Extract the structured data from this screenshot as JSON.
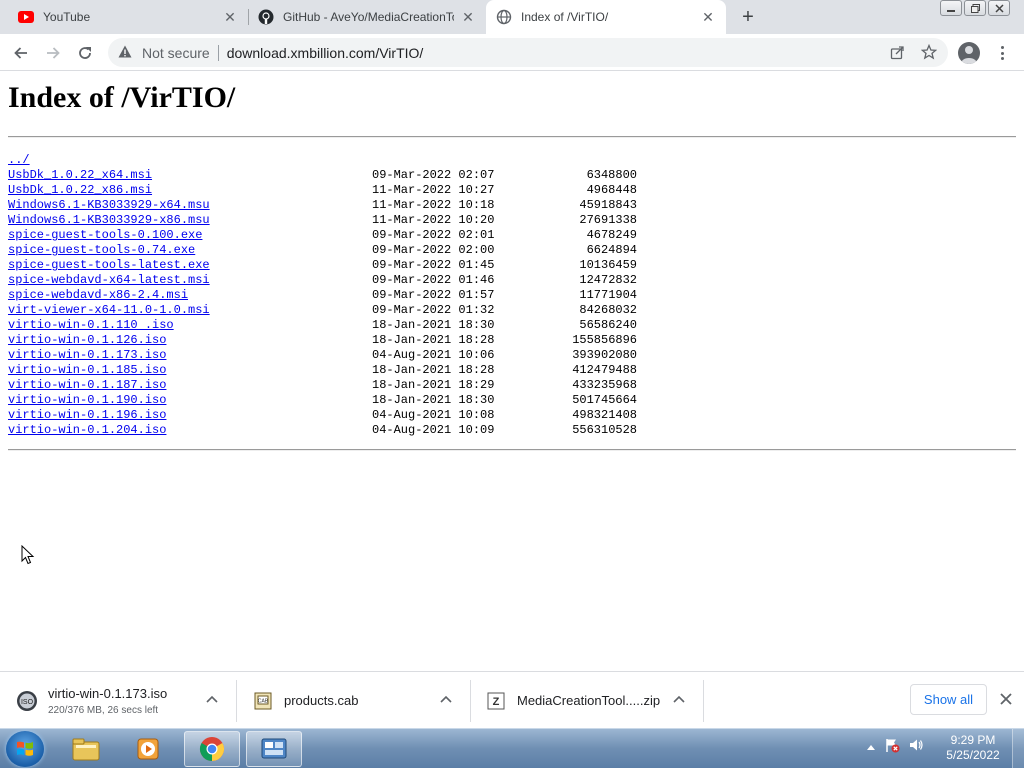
{
  "browser": {
    "tabs": [
      {
        "title": "YouTube",
        "icon": "youtube-icon"
      },
      {
        "title": "GitHub - AveYo/MediaCreationTool",
        "icon": "github-icon"
      },
      {
        "title": "Index of /VirTIO/",
        "icon": "globe-icon",
        "active": true
      }
    ],
    "new_tab": "+",
    "security_label": "Not secure",
    "url": "download.xmbillion.com/VirTIO/"
  },
  "page": {
    "heading": "Index of /VirTIO/",
    "parent_link": "../",
    "files": [
      {
        "name": "UsbDk_1.0.22_x64.msi",
        "date": "09-Mar-2022 02:07",
        "size": "6348800"
      },
      {
        "name": "UsbDk_1.0.22_x86.msi",
        "date": "11-Mar-2022 10:27",
        "size": "4968448"
      },
      {
        "name": "Windows6.1-KB3033929-x64.msu",
        "date": "11-Mar-2022 10:18",
        "size": "45918843"
      },
      {
        "name": "Windows6.1-KB3033929-x86.msu",
        "date": "11-Mar-2022 10:20",
        "size": "27691338"
      },
      {
        "name": "spice-guest-tools-0.100.exe",
        "date": "09-Mar-2022 02:01",
        "size": "4678249"
      },
      {
        "name": "spice-guest-tools-0.74.exe",
        "date": "09-Mar-2022 02:00",
        "size": "6624894"
      },
      {
        "name": "spice-guest-tools-latest.exe",
        "date": "09-Mar-2022 01:45",
        "size": "10136459"
      },
      {
        "name": "spice-webdavd-x64-latest.msi",
        "date": "09-Mar-2022 01:46",
        "size": "12472832"
      },
      {
        "name": "spice-webdavd-x86-2.4.msi",
        "date": "09-Mar-2022 01:57",
        "size": "11771904"
      },
      {
        "name": "virt-viewer-x64-11.0-1.0.msi",
        "date": "09-Mar-2022 01:32",
        "size": "84268032"
      },
      {
        "name": "virtio-win-0.1.110 .iso",
        "date": "18-Jan-2021 18:30",
        "size": "56586240"
      },
      {
        "name": "virtio-win-0.1.126.iso",
        "date": "18-Jan-2021 18:28",
        "size": "155856896"
      },
      {
        "name": "virtio-win-0.1.173.iso",
        "date": "04-Aug-2021 10:06",
        "size": "393902080"
      },
      {
        "name": "virtio-win-0.1.185.iso",
        "date": "18-Jan-2021 18:28",
        "size": "412479488"
      },
      {
        "name": "virtio-win-0.1.187.iso",
        "date": "18-Jan-2021 18:29",
        "size": "433235968"
      },
      {
        "name": "virtio-win-0.1.190.iso",
        "date": "18-Jan-2021 18:30",
        "size": "501745664"
      },
      {
        "name": "virtio-win-0.1.196.iso",
        "date": "04-Aug-2021 10:08",
        "size": "498321408"
      },
      {
        "name": "virtio-win-0.1.204.iso",
        "date": "04-Aug-2021 10:09",
        "size": "556310528"
      }
    ]
  },
  "downloads": {
    "items": [
      {
        "name": "virtio-win-0.1.173.iso",
        "status": "220/376 MB, 26 secs left",
        "icon": "iso-file-icon"
      },
      {
        "name": "products.cab",
        "status": "",
        "icon": "cab-file-icon"
      },
      {
        "name": "MediaCreationTool.....zip",
        "status": "",
        "icon": "zip-file-icon"
      }
    ],
    "show_all": "Show all"
  },
  "taskbar": {
    "clock_time": "9:29 PM",
    "clock_date": "5/25/2022"
  },
  "colors": {
    "link": "#0000ee",
    "tabstrip": "#dee1e6",
    "accent": "#1a73e8"
  }
}
